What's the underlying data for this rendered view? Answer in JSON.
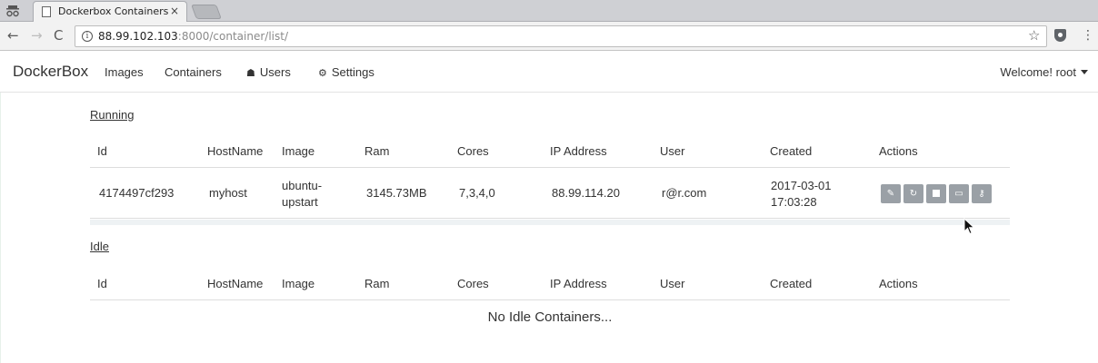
{
  "browser": {
    "tab_title": "Dockerbox Containers",
    "tab_close": "×",
    "url_host": "88.99.102.103",
    "url_rest": ":8000/container/list/",
    "info_glyph": "i",
    "back_glyph": "←",
    "forward_glyph": "→",
    "reload_glyph": "C",
    "star_glyph": "☆",
    "menu_glyph": "⋮"
  },
  "navbar": {
    "brand": "DockerBox",
    "links": [
      "Images",
      "Containers",
      "Users",
      "Settings"
    ],
    "users_icon_glyph": "☗",
    "settings_icon_glyph": "⚙",
    "welcome": "Welcome! root"
  },
  "running": {
    "title": "Running",
    "columns": [
      "Id",
      "HostName",
      "Image",
      "Ram",
      "Cores",
      "IP Address",
      "User",
      "Created",
      "Actions"
    ],
    "rows": [
      {
        "id": "4174497cf293",
        "hostname": "myhost",
        "image_line1": "ubuntu-",
        "image_line2": "upstart",
        "ram": "3145.73MB",
        "cores": "7,3,4,0",
        "ip": "88.99.114.20",
        "user": "r@r.com",
        "created_date": "2017-03-01",
        "created_time": "17:03:28",
        "actions": [
          {
            "name": "edit",
            "glyph": "✎"
          },
          {
            "name": "restart",
            "glyph": "↻"
          },
          {
            "name": "stop",
            "glyph": ""
          },
          {
            "name": "terminal",
            "glyph": "▭"
          },
          {
            "name": "key",
            "glyph": "⚷"
          }
        ]
      }
    ]
  },
  "idle": {
    "title": "Idle",
    "columns": [
      "Id",
      "HostName",
      "Image",
      "Ram",
      "Cores",
      "IP Address",
      "User",
      "Created",
      "Actions"
    ],
    "empty_message": "No Idle Containers..."
  },
  "colors": {
    "action_button": "#9aa0a6",
    "border": "#dddddd",
    "band": "#eef2f4"
  }
}
